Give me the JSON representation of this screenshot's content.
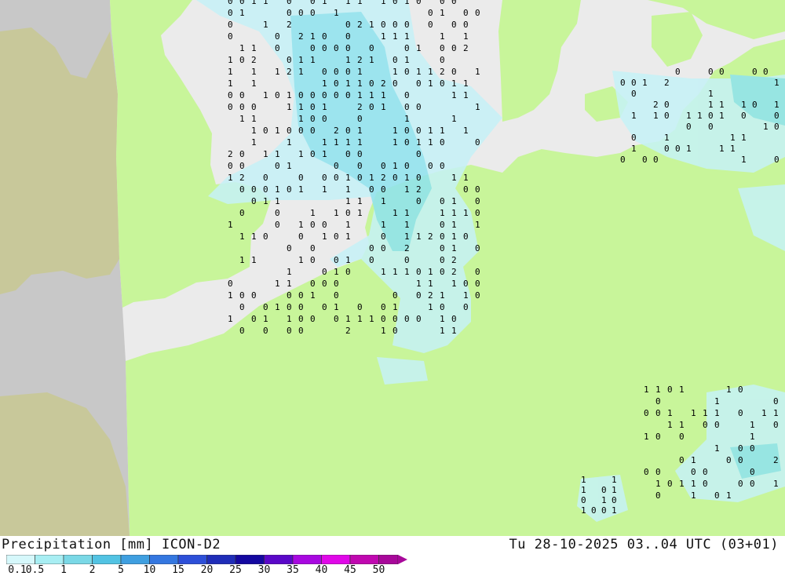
{
  "header": {
    "title_left": "Precipitation [mm] ICON-D2",
    "title_right": "Tu 28-10-2025 03..04 UTC (03+01)"
  },
  "legend": {
    "ticks": [
      "0.1",
      "0.5",
      "1",
      "2",
      "5",
      "10",
      "15",
      "20",
      "25",
      "30",
      "35",
      "40",
      "45",
      "50"
    ],
    "colors": [
      "#d6f8fb",
      "#a8eef3",
      "#7ad8e6",
      "#52c3e3",
      "#3f9fe0",
      "#3477e0",
      "#2d4fd8",
      "#1f2db8",
      "#1408a0",
      "#5a08c8",
      "#a808e0",
      "#e008e8",
      "#c008b0",
      "#a8089a"
    ]
  },
  "map": {
    "colors": {
      "sea": "#ebebeb",
      "land": "#c8f59a",
      "outside": "#c8c8c8",
      "outside_land": "#c8c89a",
      "precip_light": "#c6f2f7",
      "precip_medium": "#8fe3ef"
    }
  }
}
